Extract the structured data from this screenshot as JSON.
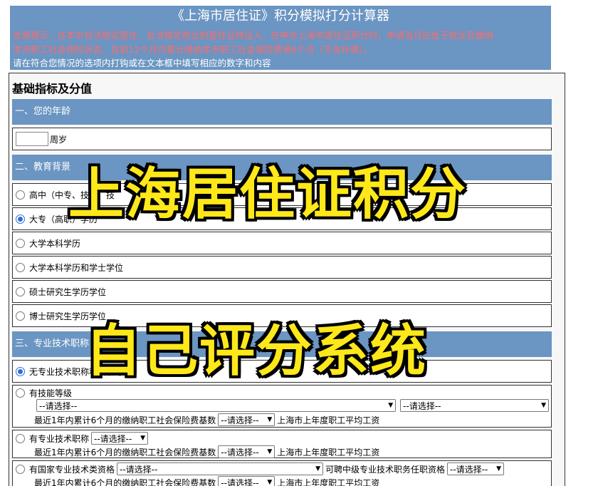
{
  "header": {
    "title": "《上海市居住证》积分模拟打分计算器",
    "notice_line1": "友情提示：在本市合法稳定居住、合法稳定就业的居住证持证人，在申办上海市居住证积分时，申请当月应处于就业及缴纳",
    "notice_line2": "本市职工社会保险状态，且前12个月内累计缴纳本市职工社会保险费满6个月（不含补缴）。",
    "hint": "请在符合您情况的选项内打钩或在文本框中填写相应的数字和内容"
  },
  "panel": {
    "title": "基础指标及分值"
  },
  "sections": {
    "age": {
      "label": "一、您的年龄",
      "unit": "周岁",
      "value": ""
    },
    "education": {
      "label": "二、教育背景",
      "options": [
        {
          "label": "高中（中专、技校、技",
          "checked": false
        },
        {
          "label": "大专（高职）学历",
          "checked": true
        },
        {
          "label": "大学本科学历",
          "checked": false
        },
        {
          "label": "大学本科学历和学士学位",
          "checked": false
        },
        {
          "label": "硕士研究生学历学位",
          "checked": false
        },
        {
          "label": "博士研究生学历学位",
          "checked": false
        }
      ]
    },
    "professional": {
      "label": "三、专业技术职称",
      "none_label": "无专业技术职称和技能等级",
      "skill_label": "有技能等级",
      "skill_select1": "--请选择--",
      "skill_select2": "--请选择--",
      "tech_label": "有专业技术职称",
      "tech_select": "--请选择--",
      "national_label": "有国家专业技术类资格",
      "national_select": "--请选择--",
      "hireable_label": "可聘中级专业技术职务任职资格",
      "hireable_select": "--请选择--",
      "insurance_prefix": "最近1年内累计6个月的缴纳职工社会保险费基数",
      "insurance_select": "--请选择--",
      "insurance_suffix": "上海市上年度职工平均工资"
    }
  },
  "overlay": {
    "line1": "上海居住证积分",
    "line2": "自己评分系统"
  }
}
